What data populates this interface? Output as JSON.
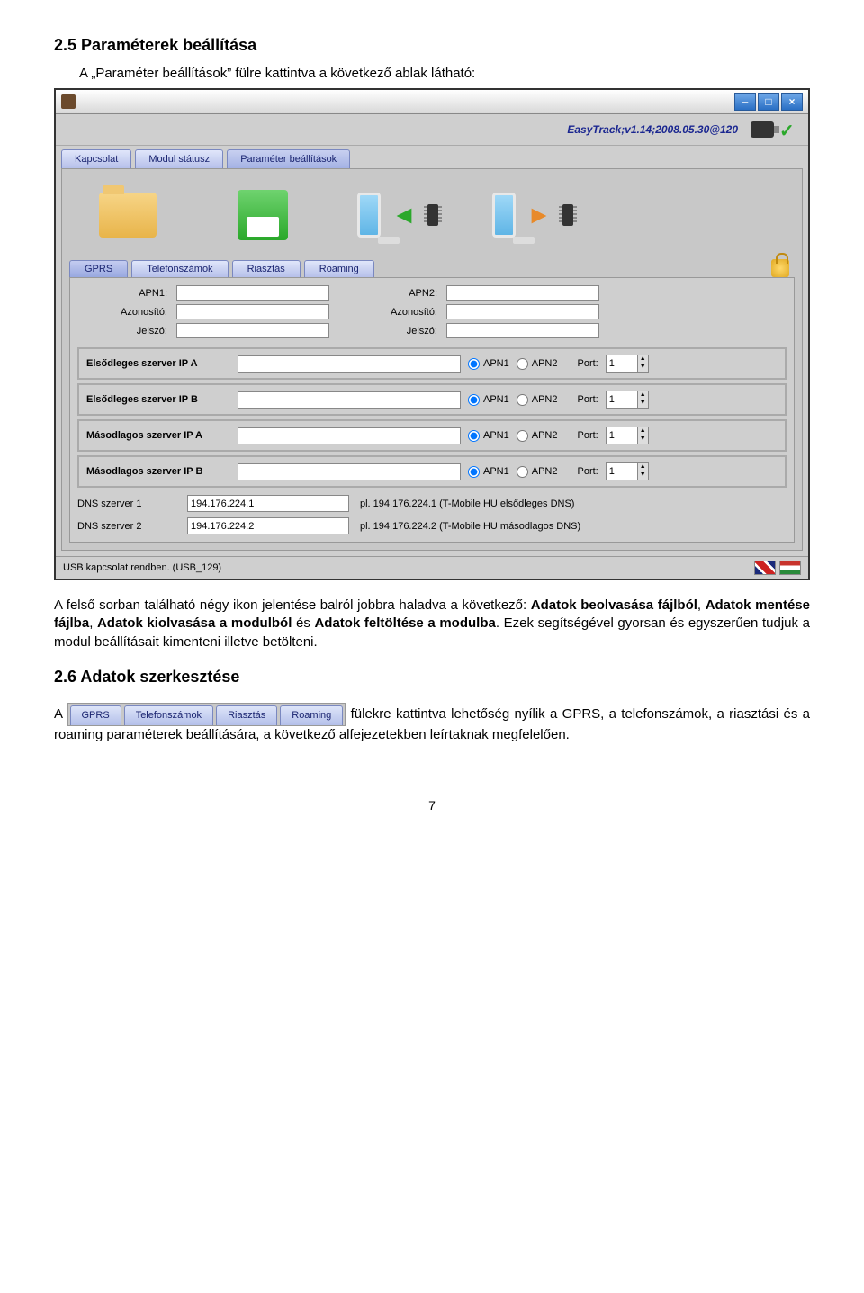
{
  "section25": {
    "title": "2.5   Paraméterek beállítása",
    "intro": "A „Paraméter beállítások” fülre kattintva a következő ablak látható:"
  },
  "app": {
    "version": "EasyTrack;v1.14;2008.05.30@120",
    "main_tabs": [
      "Kapcsolat",
      "Modul státusz",
      "Paraméter beállítások"
    ],
    "sub_tabs": [
      "GPRS",
      "Telefonszámok",
      "Riasztás",
      "Roaming"
    ],
    "form": {
      "apn1_label": "APN1:",
      "apn2_label": "APN2:",
      "azon_label": "Azonosító:",
      "jelszo_label": "Jelszó:",
      "servers": [
        {
          "label": "Elsődleges szerver IP A",
          "port": "1"
        },
        {
          "label": "Elsődleges szerver IP B",
          "port": "1"
        },
        {
          "label": "Másodlagos szerver IP A",
          "port": "1"
        },
        {
          "label": "Másodlagos szerver IP B",
          "port": "1"
        }
      ],
      "apn1_radio": "APN1",
      "apn2_radio": "APN2",
      "port_label": "Port:",
      "dns1_label": "DNS szerver 1",
      "dns2_label": "DNS szerver 2",
      "dns1_value": "194.176.224.1",
      "dns2_value": "194.176.224.2",
      "dns1_hint": "pl. 194.176.224.1    (T-Mobile HU elsődleges DNS)",
      "dns2_hint": "pl. 194.176.224.2    (T-Mobile HU másodlagos DNS)"
    },
    "status": "USB kapcsolat rendben. (USB_129)"
  },
  "para1_pre": "A felső sorban található négy ikon jelentése balról jobbra haladva a következő: ",
  "para1_b1": "Adatok beolvasása fájlból",
  "para1_mid1": ", ",
  "para1_b2": "Adatok mentése fájlba",
  "para1_mid2": ", ",
  "para1_b3": "Adatok kiolvasása a modulból",
  "para1_mid3": " és ",
  "para1_b4": "Adatok feltöltése a modulba",
  "para1_post": ". Ezek segítségével gyorsan és egyszerűen tudjuk a modul beállításait kimenteni illetve betölteni.",
  "section26": {
    "title": "2.6   Adatok szerkesztése",
    "para_pre": "A ",
    "para_post": " fülekre kattintva lehetőség nyílik a GPRS, a telefonszámok, a riasztási és a roaming paraméterek beállítására, a következő alfejezetekben leírtaknak megfelelően."
  },
  "page_number": "7"
}
